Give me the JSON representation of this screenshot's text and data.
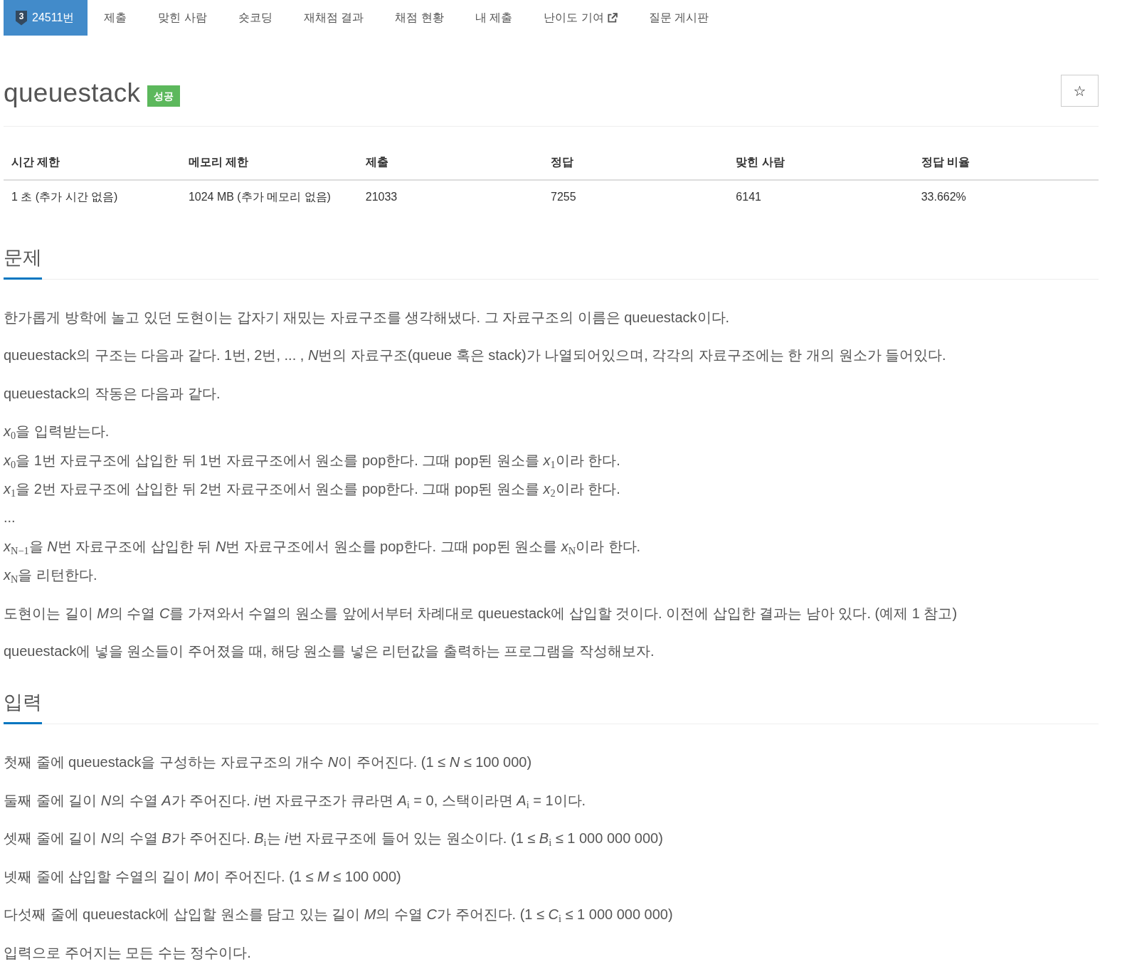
{
  "nav": {
    "tabs": [
      {
        "label": "24511번",
        "badge": "3",
        "selected": true,
        "external": false
      },
      {
        "label": "제출",
        "selected": false,
        "external": false
      },
      {
        "label": "맞힌 사람",
        "selected": false,
        "external": false
      },
      {
        "label": "숏코딩",
        "selected": false,
        "external": false
      },
      {
        "label": "재채점 결과",
        "selected": false,
        "external": false
      },
      {
        "label": "채점 현황",
        "selected": false,
        "external": false
      },
      {
        "label": "내 제출",
        "selected": false,
        "external": false
      },
      {
        "label": "난이도 기여",
        "selected": false,
        "external": true
      },
      {
        "label": "질문 게시판",
        "selected": false,
        "external": false
      }
    ]
  },
  "problem": {
    "title": "queuestack",
    "status_badge": "성공",
    "star_button": "☆"
  },
  "info_table": {
    "columns": [
      "시간 제한",
      "메모리 제한",
      "제출",
      "정답",
      "맞힌 사람",
      "정답 비율"
    ],
    "rows": [
      [
        "1 초 (추가 시간 없음)",
        "1024 MB (추가 메모리 없음)",
        "21033",
        "7255",
        "6141",
        "33.662%"
      ]
    ]
  },
  "sections": [
    {
      "heading": "문제",
      "paragraphs": [
        {
          "lines": [
            [
              "한가롭게 방학에 놀고 있던 도현이는 갑자기 재밌는 자료구조를 생각해냈다. 그 자료구조의 이름은 queuestack이다."
            ]
          ]
        },
        {
          "lines": [
            [
              "queuestack의 구조는 다음과 같다. 1번, 2번, ... , ",
              "*N*",
              "번의 자료구조(queue 혹은 stack)가 나열되어있으며, 각각의 자료구조에는 한 개의 원소가 들어있다."
            ]
          ]
        },
        {
          "lines": [
            [
              "queuestack의 작동은 다음과 같다."
            ]
          ]
        },
        {
          "lines": [
            [
              "*x*$_{0}$을 입력받는다."
            ],
            [
              "*x*$_{0}$을 1번 자료구조에 삽입한 뒤 1번 자료구조에서 원소를 pop한다. 그때 pop된 원소를 *x*$_{1}$이라 한다."
            ],
            [
              "*x*$_{1}$을 2번 자료구조에 삽입한 뒤 2번 자료구조에서 원소를 pop한다. 그때 pop된 원소를 *x*$_{2}$이라 한다."
            ],
            [
              "..."
            ],
            [
              "*x*$_{N−1}$을 ",
              "*N*",
              "번 자료구조에 삽입한 뒤 ",
              "*N*",
              "번 자료구조에서 원소를 pop한다. 그때 pop된 원소를 *x*$_{N}$이라 한다."
            ],
            [
              "*x*$_{N}$을 리턴한다."
            ]
          ]
        },
        {
          "lines": [
            [
              "도현이는 길이 ",
              "*M*",
              "의 수열 ",
              "*C*",
              "를 가져와서 수열의 원소를 앞에서부터 차례대로 queuestack에 삽입할 것이다. 이전에 삽입한 결과는 남아 있다. (예제 1 참고)"
            ]
          ]
        },
        {
          "lines": [
            [
              "queuestack에 넣을 원소들이 주어졌을 때, 해당 원소를 넣은 리턴값을 출력하는 프로그램을 작성해보자."
            ]
          ]
        }
      ]
    },
    {
      "heading": "입력",
      "paragraphs": [
        {
          "lines": [
            [
              "첫째 줄에 queuestack을 구성하는 자료구조의 개수 ",
              "*N*",
              "이 주어진다. (1 ≤ *N* ≤ 100 000)"
            ]
          ]
        },
        {
          "lines": [
            [
              "둘째 줄에 길이 ",
              "*N*",
              "의 수열 ",
              "*A*",
              "가 주어진다. ",
              "*i*",
              "번 자료구조가 큐라면 *A*$_{i}$ = 0, 스택이라면 *A*$_{i}$ = 1이다."
            ]
          ]
        },
        {
          "lines": [
            [
              "셋째 줄에 길이 ",
              "*N*",
              "의 수열 ",
              "*B*",
              "가 주어진다. *B*$_{i}$는 ",
              "*i*",
              "번 자료구조에 들어 있는 원소이다. (1 ≤ *B*$_{i}$ ≤ 1 000 000 000)"
            ]
          ]
        },
        {
          "lines": [
            [
              "넷째 줄에 삽입할 수열의 길이 ",
              "*M*",
              "이 주어진다. (1 ≤ *M* ≤ 100 000)"
            ]
          ]
        },
        {
          "lines": [
            [
              "다섯째 줄에 queuestack에 삽입할 원소를 담고 있는 길이 ",
              "*M*",
              "의 수열 ",
              "*C*",
              "가 주어진다. (1 ≤ *C*$_{i}$ ≤ 1 000 000 000)"
            ]
          ]
        },
        {
          "lines": [
            [
              "입력으로 주어지는 모든 수는 정수이다."
            ]
          ]
        }
      ]
    }
  ]
}
